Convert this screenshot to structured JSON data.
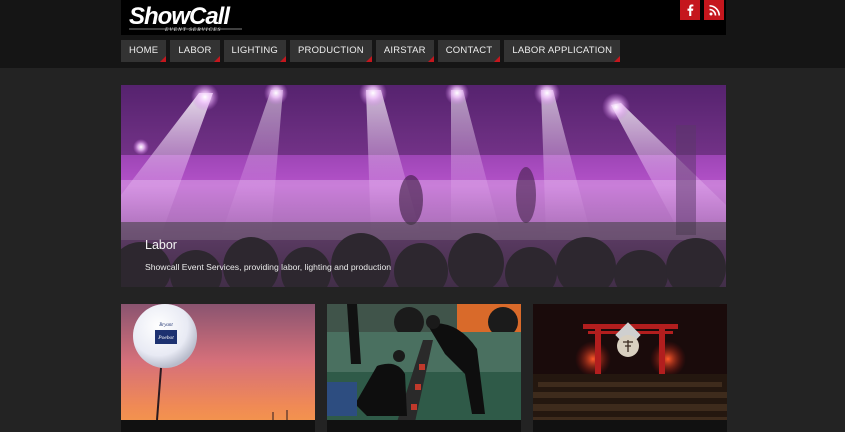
{
  "brand": {
    "logo_text": "ShowCall",
    "logo_tagline": "EVENT SERVICES",
    "accent_color": "#c5161d"
  },
  "social": {
    "facebook_icon": "facebook-icon",
    "rss_icon": "rss-icon"
  },
  "nav": {
    "items": [
      {
        "label": "HOME"
      },
      {
        "label": "LABOR"
      },
      {
        "label": "LIGHTING"
      },
      {
        "label": "PRODUCTION"
      },
      {
        "label": "AIRSTAR"
      },
      {
        "label": "CONTACT"
      },
      {
        "label": "LABOR APPLICATION"
      }
    ]
  },
  "hero": {
    "title": "Labor",
    "subtitle": "Showcall Event Services, providing labor, lighting and production"
  },
  "thumbnails": [
    {
      "balloon_text": "Bryant Poebot"
    },
    {},
    {}
  ]
}
